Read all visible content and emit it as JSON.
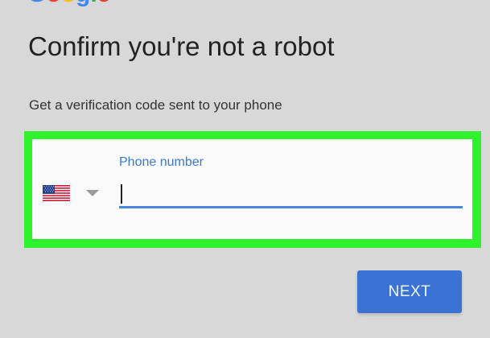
{
  "logo": {
    "letters": [
      "G",
      "o",
      "o",
      "g",
      "l",
      "e"
    ],
    "colors": [
      "#4285f4",
      "#ea4335",
      "#fbbc05",
      "#4285f4",
      "#34a853",
      "#ea4335"
    ]
  },
  "title": "Confirm you're not a robot",
  "subtitle": "Get a verification code sent to your phone",
  "phone": {
    "country_flag": "us-flag-icon",
    "label": "Phone number",
    "value": "",
    "placeholder": ""
  },
  "next_button": {
    "label": "NEXT"
  },
  "colors": {
    "background": "#d8d8d8",
    "highlight": "#2ef22e",
    "accent": "#3b73d4",
    "label_blue": "#3b78d4"
  }
}
